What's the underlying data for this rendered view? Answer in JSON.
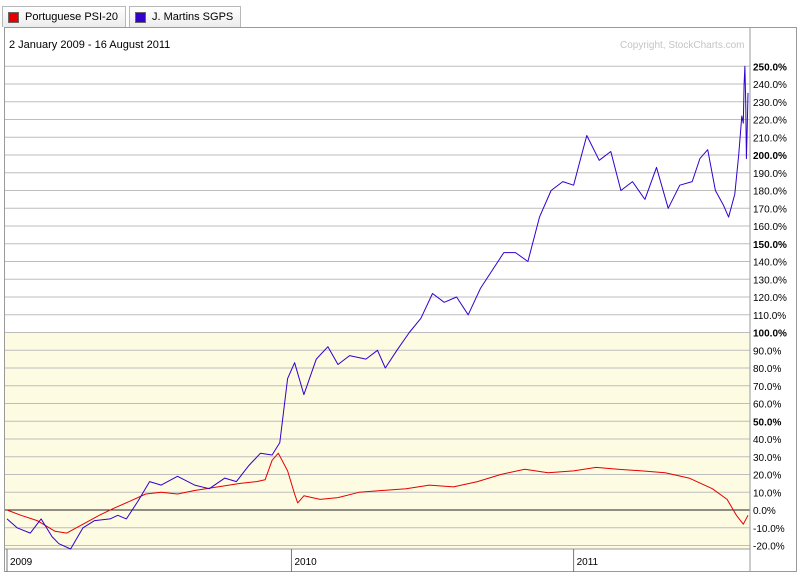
{
  "legend": {
    "items": [
      {
        "label": "Portuguese PSI-20",
        "color": "#e60000"
      },
      {
        "label": "J. Martins SGPS",
        "color": "#3300cc"
      }
    ]
  },
  "header": {
    "date_range": "2 January 2009 - 16 August 2011",
    "copyright": "Copyright, StockCharts.com"
  },
  "chart_data": {
    "type": "line",
    "y_unit": "%",
    "ylim": [
      -22,
      259
    ],
    "grid": true,
    "y_ticks": [
      -20,
      -10,
      0,
      10,
      20,
      30,
      40,
      50,
      60,
      70,
      80,
      90,
      100,
      110,
      120,
      130,
      140,
      150,
      160,
      170,
      180,
      190,
      200,
      210,
      220,
      230,
      240,
      250
    ],
    "y_tick_labels": [
      "-20.0%",
      "-10.0%",
      "0.0%",
      "10.0%",
      "20.0%",
      "30.0%",
      "40.0%",
      "50.0%",
      "60.0%",
      "70.0%",
      "80.0%",
      "90.0%",
      "100.0%",
      "110.0%",
      "120.0%",
      "130.0%",
      "140.0%",
      "150.0%",
      "160.0%",
      "170.0%",
      "180.0%",
      "190.0%",
      "200.0%",
      "210.0%",
      "220.0%",
      "230.0%",
      "240.0%",
      "250.0%"
    ],
    "bold_ticks": [
      50,
      100,
      150,
      200,
      250
    ],
    "x_tick_labels": [
      {
        "label": "2009",
        "date": "2009-01-02"
      },
      {
        "label": "2010",
        "date": "2010-01-04"
      },
      {
        "label": "2011",
        "date": "2011-01-03"
      }
    ],
    "x_start": "2009-01-02",
    "x_end": "2011-08-16",
    "series": [
      {
        "name": "Portuguese PSI-20",
        "color": "#e60000",
        "points": [
          [
            "2009-01-02",
            0
          ],
          [
            "2009-01-20",
            -3
          ],
          [
            "2009-02-10",
            -6
          ],
          [
            "2009-03-05",
            -12
          ],
          [
            "2009-03-20",
            -13
          ],
          [
            "2009-04-10",
            -8
          ],
          [
            "2009-05-01",
            -3
          ],
          [
            "2009-05-20",
            1
          ],
          [
            "2009-06-10",
            5
          ],
          [
            "2009-06-30",
            9
          ],
          [
            "2009-07-20",
            10
          ],
          [
            "2009-08-10",
            9
          ],
          [
            "2009-09-01",
            11
          ],
          [
            "2009-10-01",
            13
          ],
          [
            "2009-10-30",
            15
          ],
          [
            "2009-11-20",
            16
          ],
          [
            "2009-12-01",
            17
          ],
          [
            "2009-12-10",
            28
          ],
          [
            "2009-12-18",
            32
          ],
          [
            "2009-12-30",
            22
          ],
          [
            "2010-01-08",
            9
          ],
          [
            "2010-01-12",
            4
          ],
          [
            "2010-01-20",
            8
          ],
          [
            "2010-02-10",
            6
          ],
          [
            "2010-03-05",
            7
          ],
          [
            "2010-04-01",
            10
          ],
          [
            "2010-05-01",
            11
          ],
          [
            "2010-06-01",
            12
          ],
          [
            "2010-07-01",
            14
          ],
          [
            "2010-08-01",
            13
          ],
          [
            "2010-09-01",
            16
          ],
          [
            "2010-10-01",
            20
          ],
          [
            "2010-11-01",
            23
          ],
          [
            "2010-12-01",
            21
          ],
          [
            "2011-01-03",
            22
          ],
          [
            "2011-02-01",
            24
          ],
          [
            "2011-03-01",
            23
          ],
          [
            "2011-04-01",
            22
          ],
          [
            "2011-05-01",
            21
          ],
          [
            "2011-06-01",
            18
          ],
          [
            "2011-07-01",
            12
          ],
          [
            "2011-07-20",
            6
          ],
          [
            "2011-08-01",
            -3
          ],
          [
            "2011-08-10",
            -8
          ],
          [
            "2011-08-16",
            -3
          ]
        ]
      },
      {
        "name": "J. Martins SGPS",
        "color": "#3300cc",
        "points": [
          [
            "2009-01-02",
            -5
          ],
          [
            "2009-01-15",
            -10
          ],
          [
            "2009-02-01",
            -13
          ],
          [
            "2009-02-15",
            -5
          ],
          [
            "2009-03-01",
            -15
          ],
          [
            "2009-03-10",
            -19
          ],
          [
            "2009-03-25",
            -22
          ],
          [
            "2009-04-10",
            -10
          ],
          [
            "2009-04-25",
            -6
          ],
          [
            "2009-05-15",
            -5
          ],
          [
            "2009-05-25",
            -3
          ],
          [
            "2009-06-05",
            -5
          ],
          [
            "2009-06-20",
            5
          ],
          [
            "2009-07-05",
            16
          ],
          [
            "2009-07-20",
            14
          ],
          [
            "2009-08-10",
            19
          ],
          [
            "2009-09-01",
            14
          ],
          [
            "2009-09-20",
            12
          ],
          [
            "2009-10-10",
            18
          ],
          [
            "2009-10-25",
            16
          ],
          [
            "2009-11-10",
            25
          ],
          [
            "2009-11-25",
            32
          ],
          [
            "2009-12-10",
            31
          ],
          [
            "2009-12-20",
            38
          ],
          [
            "2009-12-30",
            74
          ],
          [
            "2010-01-08",
            83
          ],
          [
            "2010-01-20",
            65
          ],
          [
            "2010-02-05",
            85
          ],
          [
            "2010-02-20",
            92
          ],
          [
            "2010-03-05",
            82
          ],
          [
            "2010-03-20",
            87
          ],
          [
            "2010-04-10",
            85
          ],
          [
            "2010-04-25",
            90
          ],
          [
            "2010-05-05",
            80
          ],
          [
            "2010-05-20",
            90
          ],
          [
            "2010-06-05",
            100
          ],
          [
            "2010-06-20",
            108
          ],
          [
            "2010-07-05",
            122
          ],
          [
            "2010-07-20",
            117
          ],
          [
            "2010-08-05",
            120
          ],
          [
            "2010-08-20",
            110
          ],
          [
            "2010-09-05",
            125
          ],
          [
            "2010-09-20",
            135
          ],
          [
            "2010-10-05",
            145
          ],
          [
            "2010-10-20",
            145
          ],
          [
            "2010-11-05",
            140
          ],
          [
            "2010-11-20",
            165
          ],
          [
            "2010-12-05",
            180
          ],
          [
            "2010-12-20",
            185
          ],
          [
            "2011-01-03",
            183
          ],
          [
            "2011-01-12",
            198
          ],
          [
            "2011-01-20",
            211
          ],
          [
            "2011-02-05",
            197
          ],
          [
            "2011-02-20",
            202
          ],
          [
            "2011-03-05",
            180
          ],
          [
            "2011-03-20",
            185
          ],
          [
            "2011-04-05",
            175
          ],
          [
            "2011-04-20",
            193
          ],
          [
            "2011-05-05",
            170
          ],
          [
            "2011-05-20",
            183
          ],
          [
            "2011-06-05",
            185
          ],
          [
            "2011-06-15",
            198
          ],
          [
            "2011-06-25",
            203
          ],
          [
            "2011-07-05",
            180
          ],
          [
            "2011-07-15",
            172
          ],
          [
            "2011-07-22",
            165
          ],
          [
            "2011-07-30",
            178
          ],
          [
            "2011-08-04",
            200
          ],
          [
            "2011-08-08",
            222
          ],
          [
            "2011-08-10",
            218
          ],
          [
            "2011-08-11",
            240
          ],
          [
            "2011-08-12",
            250
          ],
          [
            "2011-08-13",
            230
          ],
          [
            "2011-08-14",
            198
          ],
          [
            "2011-08-15",
            215
          ],
          [
            "2011-08-16",
            235
          ]
        ]
      }
    ]
  }
}
